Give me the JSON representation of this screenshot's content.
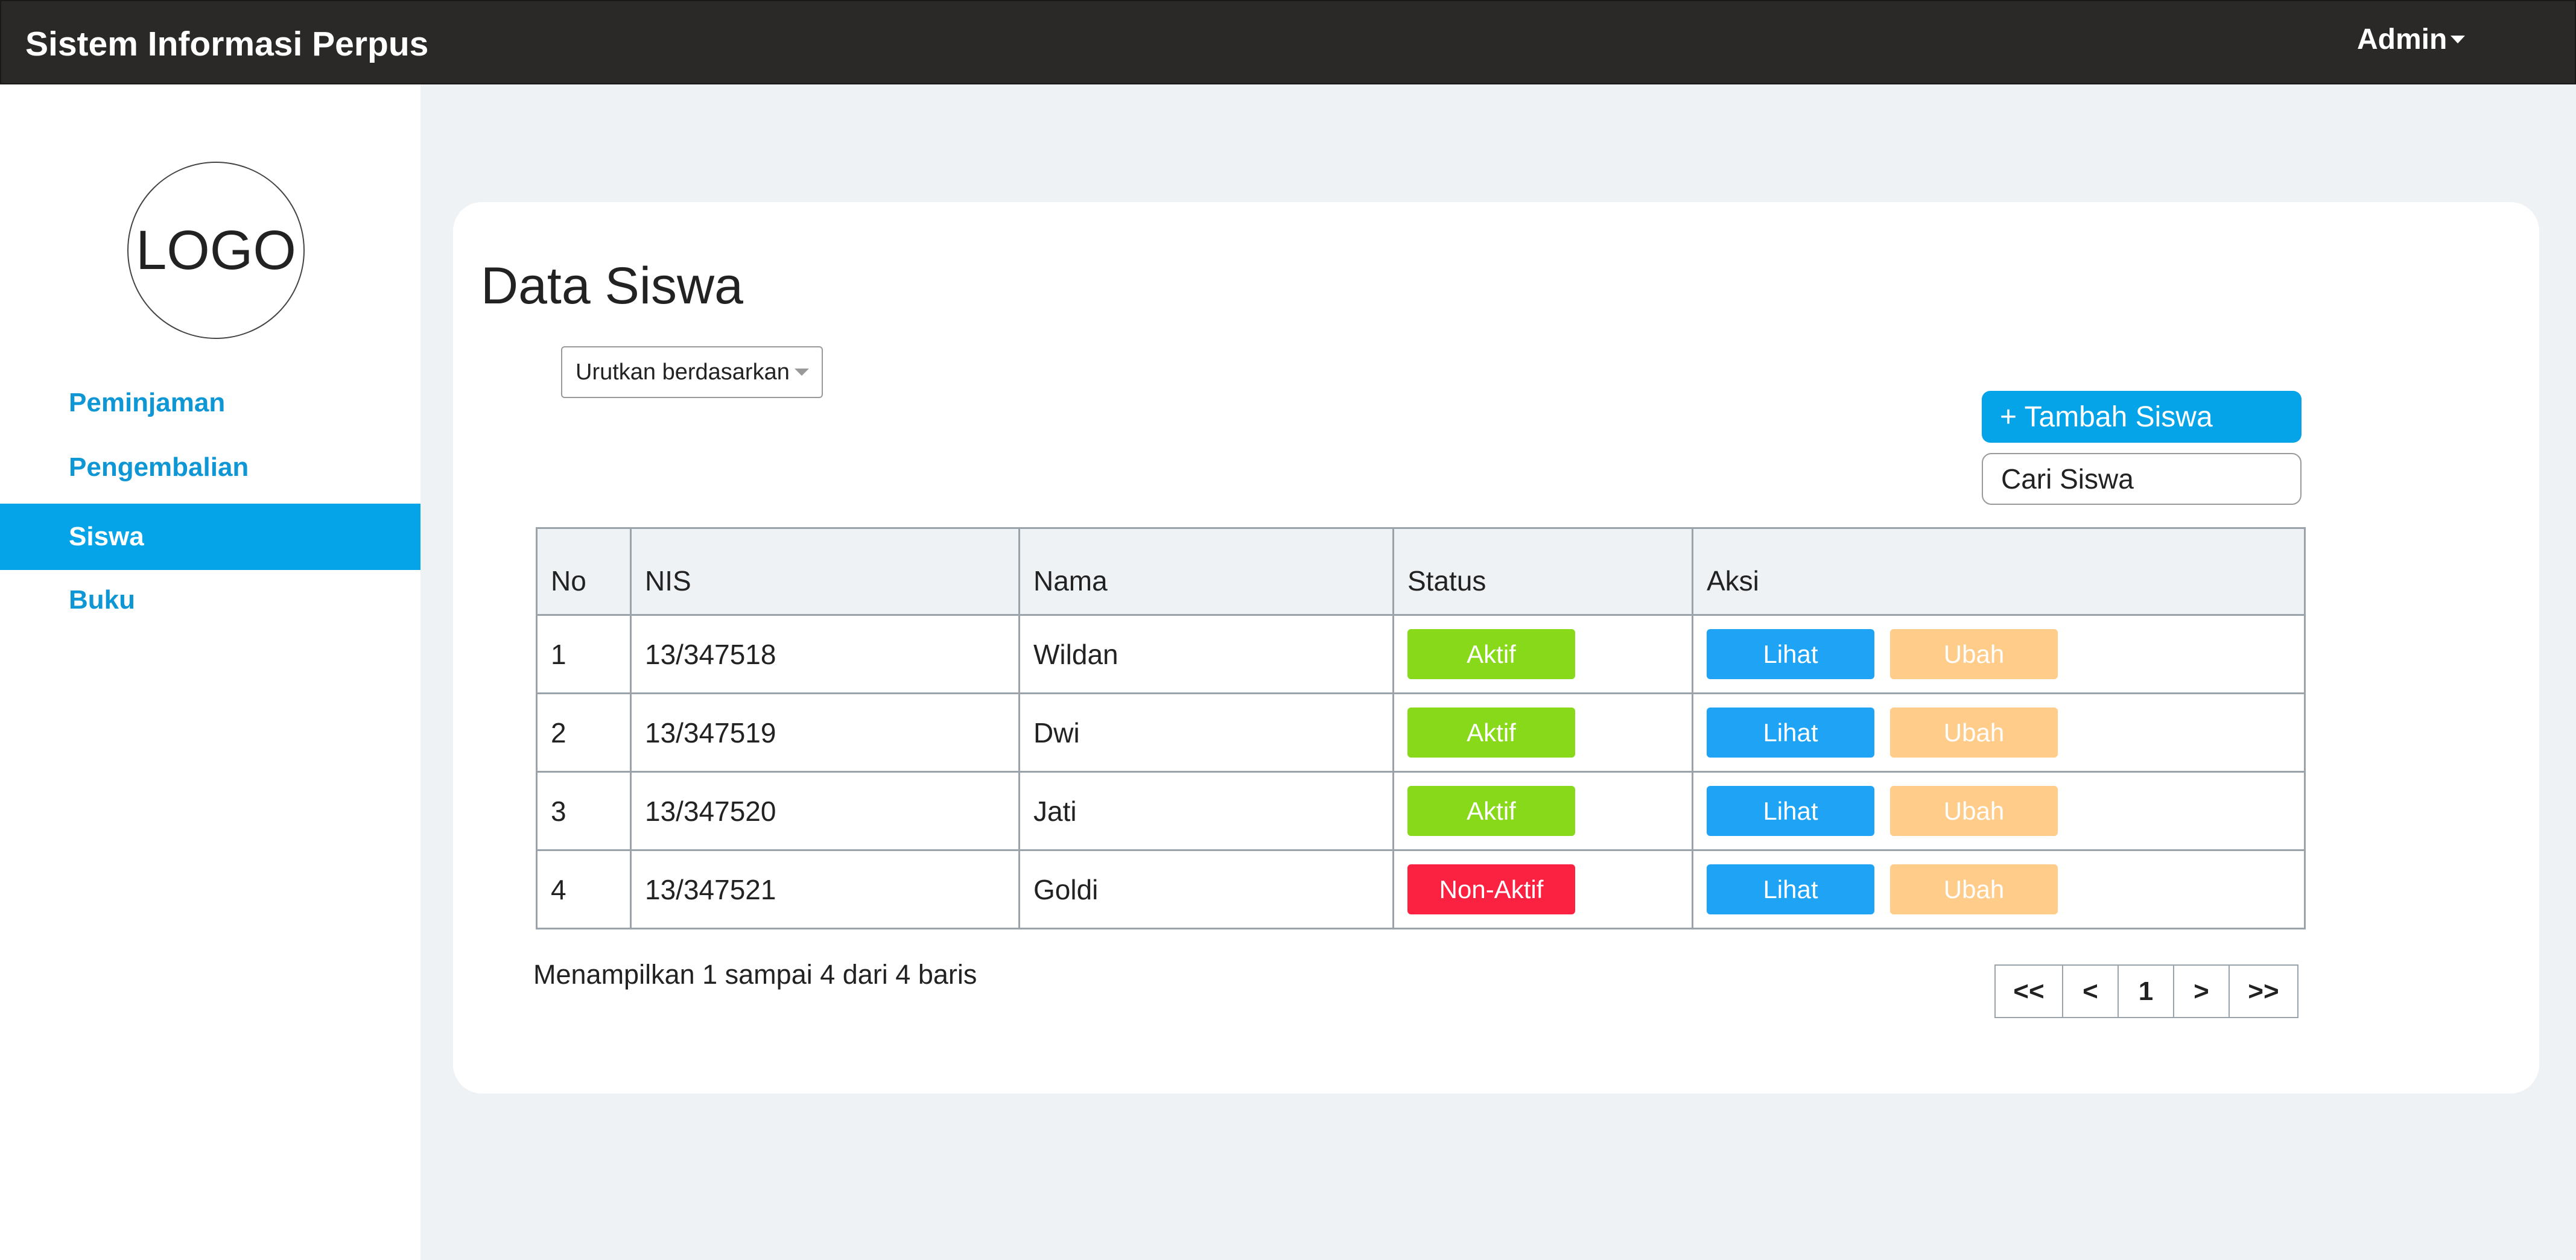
{
  "header": {
    "title": "Sistem Informasi Perpus",
    "user_menu": "Admin"
  },
  "sidebar": {
    "logo_text": "LOGO",
    "items": [
      {
        "label": "Peminjaman",
        "active": false
      },
      {
        "label": "Pengembalian",
        "active": false
      },
      {
        "label": "Siswa",
        "active": true
      },
      {
        "label": "Buku",
        "active": false
      }
    ]
  },
  "main": {
    "title": "Data Siswa",
    "sort_label": "Urutkan berdasarkan",
    "add_button": "+ Tambah Siswa",
    "search_placeholder": "Cari Siswa",
    "table": {
      "columns": [
        "No",
        "NIS",
        "Nama",
        "Status",
        "Aksi"
      ],
      "rows": [
        {
          "no": "1",
          "nis": "13/347518",
          "nama": "Wildan",
          "status": "Aktif",
          "view": "Lihat",
          "edit": "Ubah"
        },
        {
          "no": "2",
          "nis": "13/347519",
          "nama": "Dwi",
          "status": "Aktif",
          "view": "Lihat",
          "edit": "Ubah"
        },
        {
          "no": "3",
          "nis": "13/347520",
          "nama": "Jati",
          "status": "Aktif",
          "view": "Lihat",
          "edit": "Ubah"
        },
        {
          "no": "4",
          "nis": "13/347521",
          "nama": "Goldi",
          "status": "Non-Aktif",
          "view": "Lihat",
          "edit": "Ubah"
        }
      ]
    },
    "summary": "Menampilkan 1 sampai 4 dari 4 baris",
    "pagination": [
      "<<",
      "<",
      "1",
      ">",
      ">>"
    ]
  },
  "colors": {
    "topbar": "#2b2927",
    "accent": "#05a3e7",
    "status_active": "#89d91b",
    "status_inactive": "#fb2141",
    "button_view": "#1ea3f5",
    "button_edit": "#ffcc8a"
  }
}
